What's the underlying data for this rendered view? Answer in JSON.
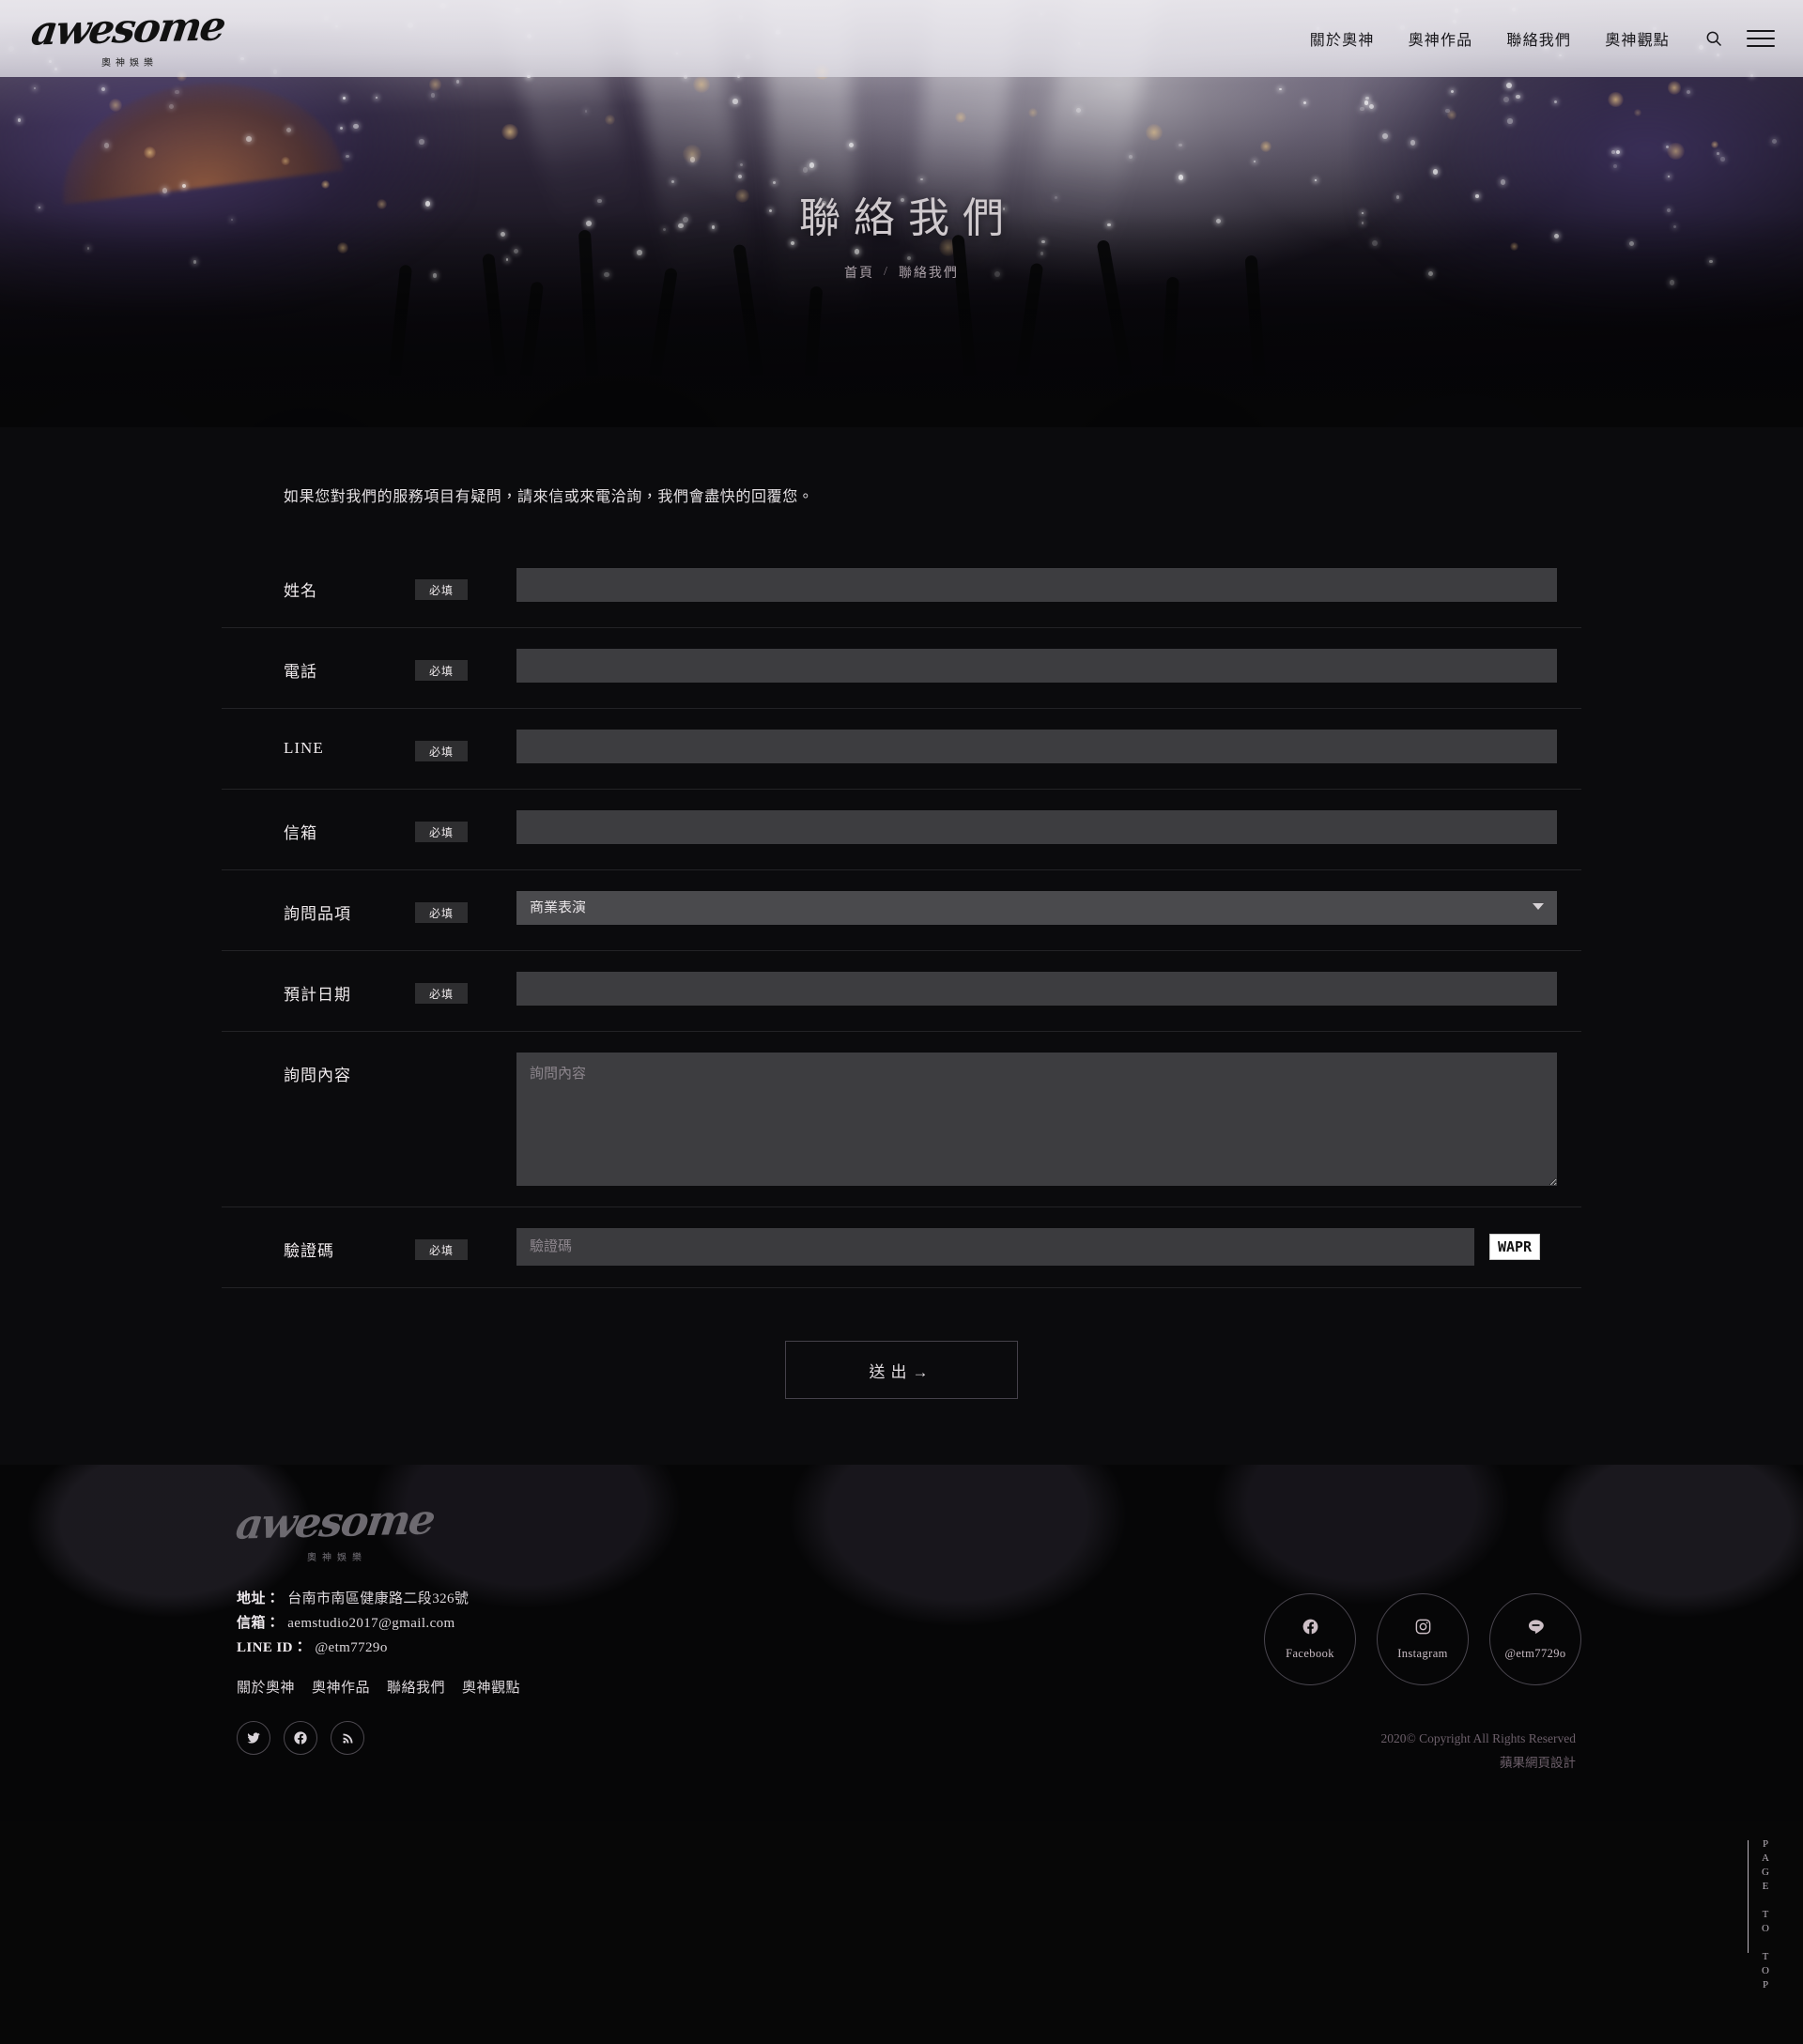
{
  "site": {
    "logo_script": "awesome",
    "logo_sub": "奧神娛樂"
  },
  "nav": {
    "items": [
      {
        "label": "關於奧神"
      },
      {
        "label": "奧神作品"
      },
      {
        "label": "聯絡我們"
      },
      {
        "label": "奧神觀點"
      }
    ],
    "search_icon": "search-icon",
    "menu_icon": "hamburger-menu-icon"
  },
  "hero": {
    "title": "聯絡我們",
    "breadcrumb": {
      "home": "首頁",
      "separator": "/",
      "current": "聯絡我們"
    }
  },
  "form": {
    "intro": "如果您對我們的服務項目有疑問，請來信或來電洽詢，我們會盡快的回覆您。",
    "required_badge": "必填",
    "fields": [
      {
        "label": "姓名",
        "required": true,
        "type": "text",
        "value": "",
        "placeholder": ""
      },
      {
        "label": "電話",
        "required": true,
        "type": "text",
        "value": "",
        "placeholder": ""
      },
      {
        "label": "LINE",
        "required": true,
        "type": "text",
        "value": "",
        "placeholder": ""
      },
      {
        "label": "信箱",
        "required": true,
        "type": "text",
        "value": "",
        "placeholder": ""
      },
      {
        "label": "詢問品項",
        "required": true,
        "type": "select",
        "value": "商業表演"
      },
      {
        "label": "預計日期",
        "required": true,
        "type": "text",
        "value": "",
        "placeholder": ""
      },
      {
        "label": "詢問內容",
        "required": false,
        "type": "textarea",
        "value": "",
        "placeholder": "詢問內容"
      },
      {
        "label": "驗證碼",
        "required": true,
        "type": "captcha",
        "value": "",
        "placeholder": "驗證碼"
      }
    ],
    "select_selected": "商業表演",
    "textarea_placeholder": "詢問內容",
    "captcha_placeholder": "驗證碼",
    "captcha_code": "WAPR",
    "submit_label": "送出→"
  },
  "footer": {
    "logo_script": "awesome",
    "logo_sub": "奧神娛樂",
    "contact": [
      {
        "label": "地址：",
        "value": "台南市南區健康路二段326號"
      },
      {
        "label": "信箱：",
        "value": "aemstudio2017@gmail.com"
      },
      {
        "label": "LINE ID：",
        "value": "@etm7729o"
      }
    ],
    "links": [
      {
        "label": "關於奧神"
      },
      {
        "label": "奧神作品"
      },
      {
        "label": "聯絡我們"
      },
      {
        "label": "奧神觀點"
      }
    ],
    "small_social": [
      {
        "name": "twitter-icon"
      },
      {
        "name": "facebook-icon"
      },
      {
        "name": "rss-icon"
      }
    ],
    "big_social": [
      {
        "icon": "facebook-icon",
        "label": "Facebook"
      },
      {
        "icon": "instagram-icon",
        "label": "Instagram"
      },
      {
        "icon": "line-icon",
        "label": "@etm7729o"
      }
    ],
    "copyright_line1": "2020© Copyright All Rights Reserved",
    "copyright_line2": "蘋果網頁設計"
  },
  "page_to_top": {
    "label": "PAGE TO TOP"
  },
  "colors": {
    "page_bg": "#0b0b0d",
    "input_bg": "#3d3d40",
    "select_bg": "#4a4a4d",
    "badge_bg": "#2e2e30",
    "divider": "#232326",
    "text": "#e8e4e0",
    "muted": "#6c5f6a"
  }
}
